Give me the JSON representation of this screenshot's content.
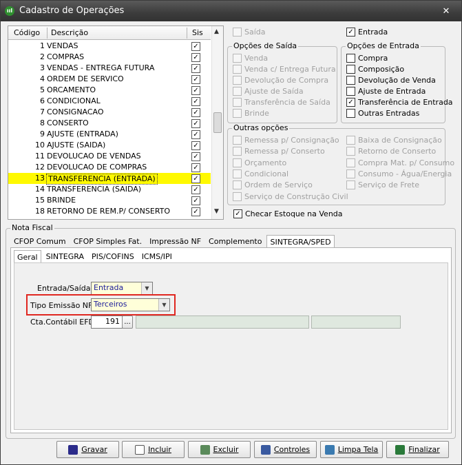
{
  "window": {
    "title": "Cadastro de Operações",
    "close": "✕"
  },
  "list": {
    "headers": {
      "code": "Código",
      "desc": "Descrição",
      "sis": "Sis"
    },
    "rows": [
      {
        "code": "1",
        "desc": "VENDAS"
      },
      {
        "code": "2",
        "desc": "COMPRAS"
      },
      {
        "code": "3",
        "desc": "VENDAS - ENTREGA FUTURA"
      },
      {
        "code": "4",
        "desc": "ORDEM DE SERVICO"
      },
      {
        "code": "5",
        "desc": "ORCAMENTO"
      },
      {
        "code": "6",
        "desc": "CONDICIONAL"
      },
      {
        "code": "7",
        "desc": "CONSIGNACAO"
      },
      {
        "code": "8",
        "desc": "CONSERTO"
      },
      {
        "code": "9",
        "desc": "AJUSTE (ENTRADA)"
      },
      {
        "code": "10",
        "desc": "AJUSTE (SAIDA)"
      },
      {
        "code": "11",
        "desc": "DEVOLUCAO DE VENDAS"
      },
      {
        "code": "12",
        "desc": "DEVOLUCAO DE COMPRAS"
      },
      {
        "code": "13",
        "desc": "TRANSFERENCIA (ENTRADA)"
      },
      {
        "code": "14",
        "desc": "TRANSFERENCIA (SAIDA)"
      },
      {
        "code": "15",
        "desc": "BRINDE"
      },
      {
        "code": "18",
        "desc": "RETORNO DE REM.P/ CONSERTO"
      }
    ],
    "selected_code": "13"
  },
  "top": {
    "saida": "Saída",
    "entrada": "Entrada"
  },
  "opcoes_saida": {
    "label": "Opções de Saída",
    "items": [
      "Venda",
      "Venda c/ Entrega Futura",
      "Devolução de Compra",
      "Ajuste de Saída",
      "Transferência de Saída",
      "Brinde"
    ]
  },
  "opcoes_entrada": {
    "label": "Opções de Entrada",
    "items": [
      "Compra",
      "Composição",
      "Devolução de Venda",
      "Ajuste de Entrada",
      "Transferência de Entrada",
      "Outras Entradas"
    ]
  },
  "outras_opcoes": {
    "label": "Outras opções",
    "left": [
      "Remessa p/ Consignação",
      "Remessa p/ Conserto",
      "Orçamento",
      "Condicional",
      "Ordem de Serviço",
      "Serviço de Construção Civil"
    ],
    "right": [
      "Baixa de Consignação",
      "Retorno de Conserto",
      "Compra Mat. p/ Consumo",
      "Consumo - Água/Energia",
      "Serviço de Frete"
    ]
  },
  "checar_estoque": "Checar Estoque na Venda",
  "nota_fiscal": {
    "label": "Nota Fiscal",
    "tabs": [
      "CFOP Comum",
      "CFOP Simples Fat.",
      "Impressão NF",
      "Complemento",
      "SINTEGRA/SPED"
    ],
    "subtabs": [
      "Geral",
      "SINTEGRA",
      "PIS/COFINS",
      "ICMS/IPI"
    ],
    "entrada_saida_label": "Entrada/Saída:",
    "entrada_saida_value": "Entrada",
    "tipo_emissao_label": "Tipo Emissão NF:",
    "tipo_emissao_value": "Terceiros",
    "cta_label": "Cta.Contábil EFD:",
    "cta_value": "191",
    "ellipsis": "..."
  },
  "buttons": {
    "gravar": "Gravar",
    "incluir": "Incluir",
    "excluir": "Excluir",
    "controles": "Controles",
    "limpa": "Limpa Tela",
    "finalizar": "Finalizar"
  },
  "colors": {
    "selected_row": "#fff900",
    "highlight_box": "#e0261f",
    "input_yellow": "#ffffd9"
  }
}
